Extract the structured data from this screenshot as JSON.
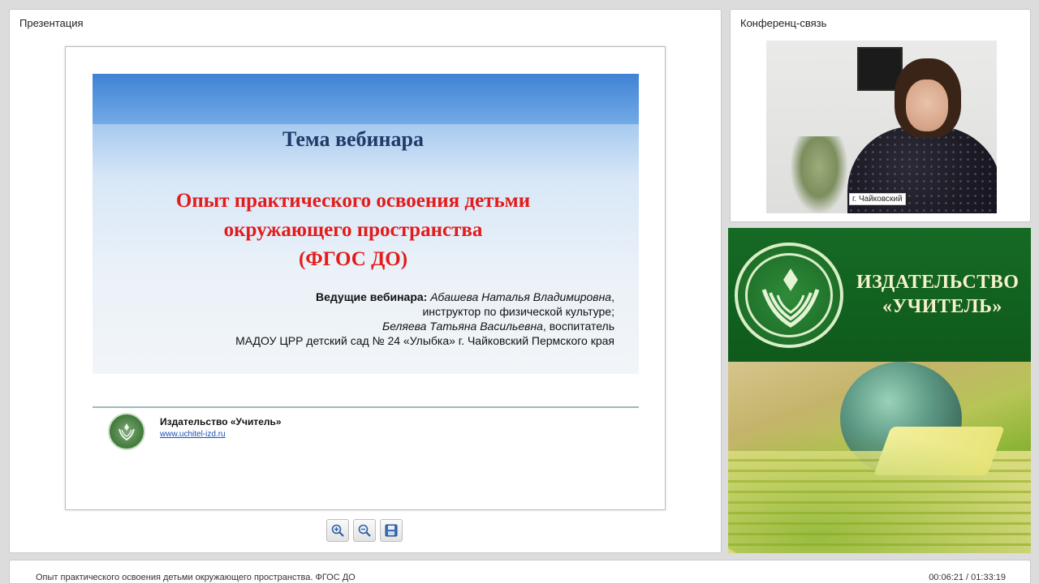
{
  "presentation": {
    "panel_title": "Презентация",
    "slide": {
      "heading": "Тема вебинара",
      "topic_line1": "Опыт практического освоения детьми",
      "topic_line2": "окружающего пространства",
      "topic_line3": "(ФГОС ДО)",
      "hosts_label": "Ведущие вебинара:",
      "host1_name": "Абашева Наталья Владимировна",
      "host1_role": "инструктор по физической культуре;",
      "host2_name": "Беляева Татьяна Васильевна",
      "host2_role": "воспитатель",
      "institution": "МАДОУ ЦРР детский сад № 24 «Улыбка» г. Чайковский Пермского края",
      "publisher": "Издательство «Учитель»",
      "website": "www.uchitel-izd.ru"
    },
    "toolbar": {
      "zoom_in_icon": "zoom-in-icon",
      "zoom_out_icon": "zoom-out-icon",
      "save_icon": "save-icon"
    }
  },
  "conference": {
    "panel_title": "Конференц-связь",
    "video_caption": "г. Чайковский"
  },
  "promo": {
    "name_line1": "ИЗДАТЕЛЬСТВО",
    "name_line2": "«УЧИТЕЛЬ»"
  },
  "footer": {
    "title": "Опыт практического освоения детьми окружающего пространства. ФГОС ДО",
    "time": "00:06:21 / 01:33:19"
  },
  "colors": {
    "slide_heading": "#1f3a68",
    "slide_topic": "#e31b1b",
    "promo_green": "#166a24",
    "link": "#1a4fb5"
  }
}
